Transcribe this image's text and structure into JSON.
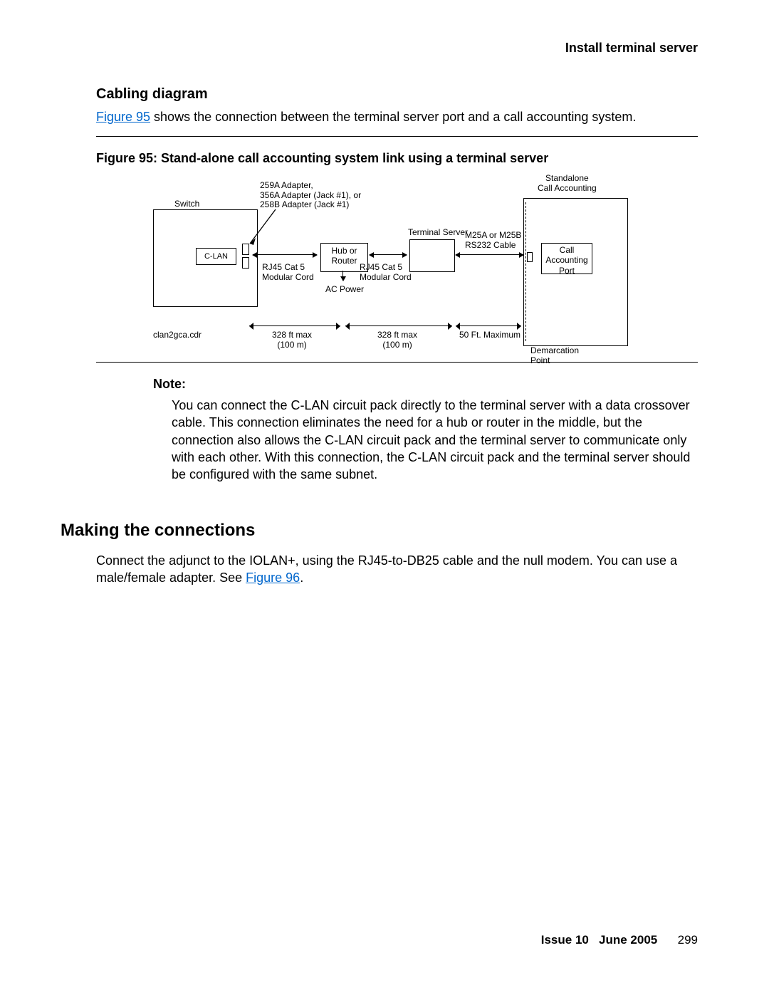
{
  "header": {
    "running": "Install terminal server"
  },
  "section1": {
    "title": "Cabling diagram",
    "intro_pre": "",
    "intro_link": "Figure 95",
    "intro_post": " shows the connection between the terminal server port and a call accounting system."
  },
  "figure": {
    "caption": "Figure 95: Stand-alone call accounting system link using a terminal server",
    "labels": {
      "switch": "Switch",
      "adapter_l1": "259A Adapter,",
      "adapter_l2": "356A Adapter (Jack #1), or",
      "adapter_l3": "258B Adapter (Jack #1)",
      "clan": "C-LAN",
      "hub_l1": "Hub or",
      "hub_l2": "Router",
      "ts": "Terminal Server",
      "cable_l1": "M25A or M25B",
      "cable_l2": "RS232 Cable",
      "standalone_l1": "Standalone",
      "standalone_l2": "Call Accounting",
      "caport_l1": "Call",
      "caport_l2": "Accounting",
      "caport_l3": "Port",
      "rj45_l1": "RJ45 Cat 5",
      "rj45_l2": "Modular Cord",
      "rj45b_l1": "RJ45 Cat 5",
      "rj45b_l2": "Modular Cord",
      "acpower": "AC Power",
      "dist1_l1": "328 ft max",
      "dist1_l2": "(100 m)",
      "dist2_l1": "328 ft max",
      "dist2_l2": "(100 m)",
      "dist3": "50 Ft. Maximum",
      "demarc_l1": "Demarcation",
      "demarc_l2": "Point",
      "file": "clan2gca.cdr"
    }
  },
  "note": {
    "head": "Note:",
    "body": "You can connect the C-LAN circuit pack directly to the terminal server with a data crossover cable. This connection eliminates the need for a hub or router in the middle, but the connection also allows the C-LAN circuit pack and the terminal server to communicate only with each other. With this connection, the C-LAN circuit pack and the terminal server should be configured with the same subnet."
  },
  "section2": {
    "title": "Making the connections",
    "body_pre": "Connect the adjunct to the IOLAN+, using the RJ45-to-DB25 cable and the null modem. You can use a male/female adapter. See ",
    "body_link": "Figure 96",
    "body_post": "."
  },
  "footer": {
    "issue": "Issue 10",
    "date": "June 2005",
    "page": "299"
  }
}
